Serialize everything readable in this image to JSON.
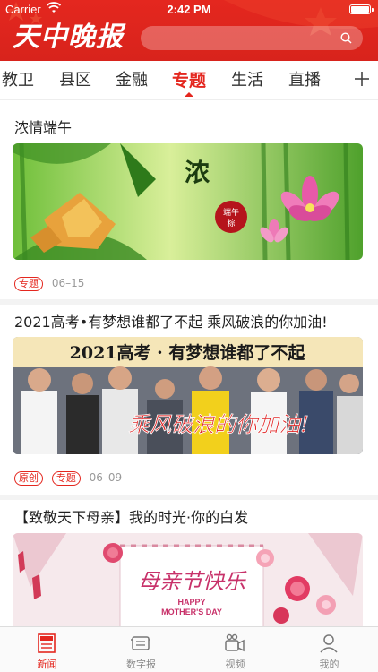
{
  "status_bar": {
    "carrier": "Carrier",
    "time": "2:42 PM"
  },
  "header": {
    "logo_text": "天中晚报",
    "search_placeholder": ""
  },
  "tabs": [
    {
      "label": "教卫",
      "active": false
    },
    {
      "label": "县区",
      "active": false
    },
    {
      "label": "金融",
      "active": false
    },
    {
      "label": "专题",
      "active": true
    },
    {
      "label": "生活",
      "active": false
    },
    {
      "label": "直播",
      "active": false
    }
  ],
  "articles": [
    {
      "title": "浓情端午",
      "image_text": [
        "浓",
        "端午",
        "粽"
      ],
      "tags": [
        "专题"
      ],
      "date": "06–15"
    },
    {
      "title": "2021高考•有梦想谁都了不起  乘风破浪的你加油!",
      "image_text": [
        "2021高考 · 有梦想谁都了不起",
        "乘风破浪的你加油!"
      ],
      "tags": [
        "原创",
        "专题"
      ],
      "date": "06–09"
    },
    {
      "title": "【致敬天下母亲】我的时光·你的白发",
      "image_text": [
        "母亲节快乐",
        "HAPPY",
        "MOTHER'S DAY"
      ],
      "tags": [],
      "date": ""
    }
  ],
  "tabbar": [
    {
      "label": "新闻",
      "icon": "newspaper-icon",
      "active": true
    },
    {
      "label": "数字报",
      "icon": "digital-paper-icon",
      "active": false
    },
    {
      "label": "视频",
      "icon": "video-camera-icon",
      "active": false
    },
    {
      "label": "我的",
      "icon": "user-icon",
      "active": false
    }
  ],
  "colors": {
    "accent": "#e4271f",
    "muted": "#999999"
  }
}
